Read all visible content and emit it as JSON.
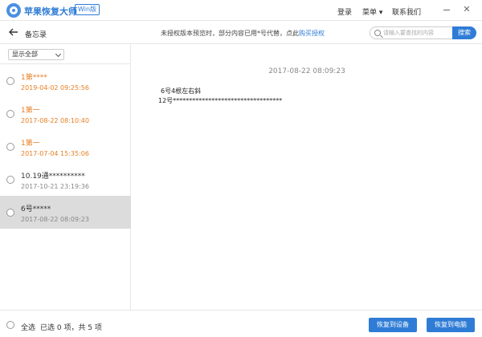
{
  "titlebar": {
    "app_name": "苹果恢复大师",
    "badge": "Win版",
    "login": "登录",
    "menu": "菜单 ▾",
    "contact": "联系我们",
    "close_glyph": "✕"
  },
  "header": {
    "page_title": "备忘录",
    "notice_prefix": "未授权版本预览时，部分内容已用*号代替，点此",
    "notice_link": "购买授权",
    "search_placeholder": "请输入要查找的内容",
    "search_button": "搜索"
  },
  "sidebar": {
    "filter": "显示全部",
    "items": [
      {
        "title": "1第****",
        "date": "2019-04-02 09:25:56"
      },
      {
        "title": "1第一",
        "date": "2017-08-22 08:10:40"
      },
      {
        "title": "1第一",
        "date": "2017-07-04 15:35:06"
      },
      {
        "title": "10.19通**********",
        "date": "2017-10-21 23:19:36"
      },
      {
        "title": "6号*****",
        "date": "2017-08-22 08:09:23"
      }
    ]
  },
  "content": {
    "date": "2017-08-22 08:09:23",
    "line1": "6号4根左右斜",
    "line2": "12号**********************************"
  },
  "footer": {
    "select_all": "全选",
    "selection_status": "已选 0 项，共 5 项",
    "restore_device": "恢复到设备",
    "restore_computer": "恢复到电脑"
  },
  "colors": {
    "accent": "#2f7cd6",
    "orange": "#e67e22",
    "selected_row": "#dcdcdc"
  }
}
